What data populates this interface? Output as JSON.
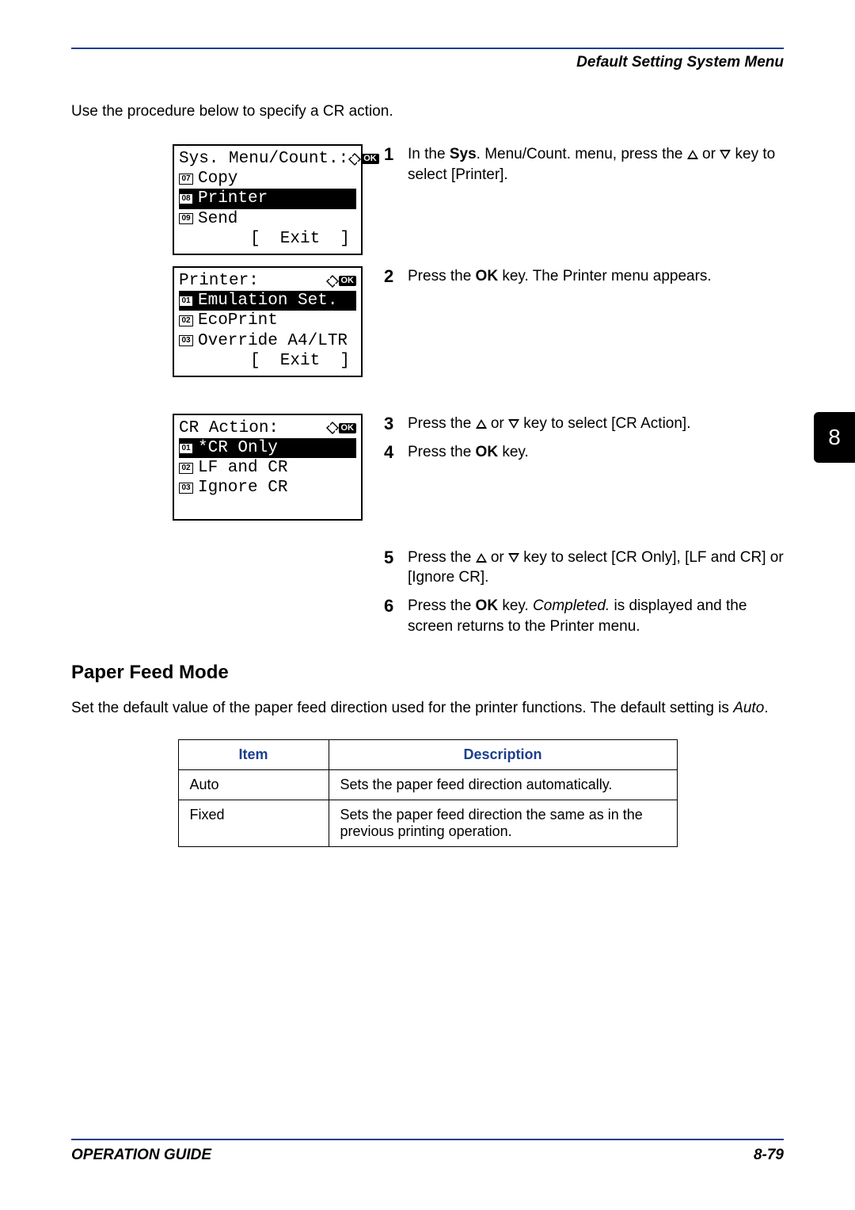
{
  "header": {
    "title": "Default Setting System Menu"
  },
  "intro": "Use the procedure below to specify a CR action.",
  "screens": {
    "s1": {
      "title": "Sys. Menu/Count.:",
      "items": [
        {
          "num": "07",
          "label": "Copy"
        },
        {
          "num": "08",
          "label": "Printer"
        },
        {
          "num": "09",
          "label": "Send"
        }
      ],
      "exit": "[  Exit  ]"
    },
    "s2": {
      "title": "Printer:",
      "items": [
        {
          "num": "01",
          "label": "Emulation Set."
        },
        {
          "num": "02",
          "label": "EcoPrint"
        },
        {
          "num": "03",
          "label": "Override A4/LTR"
        }
      ],
      "exit": "[  Exit  ]"
    },
    "s3": {
      "title": "CR Action:",
      "items": [
        {
          "num": "01",
          "label": "*CR Only"
        },
        {
          "num": "02",
          "label": "LF and CR"
        },
        {
          "num": "03",
          "label": "Ignore CR"
        }
      ]
    }
  },
  "steps": {
    "n1": "1",
    "t1a": "In the ",
    "t1b": "Sys",
    "t1c": ". Menu/Count. menu, press the ",
    "t1d": " or ",
    "t1e": " key to select [Printer].",
    "n2": "2",
    "t2a": "Press the ",
    "t2b": "OK",
    "t2c": " key. The Printer menu appears.",
    "n3": "3",
    "t3a": "Press the ",
    "t3b": " or ",
    "t3c": " key to select [CR Action].",
    "n4": "4",
    "t4a": "Press the ",
    "t4b": "OK",
    "t4c": " key.",
    "n5": "5",
    "t5a": "Press the ",
    "t5b": " or ",
    "t5c": " key to select [CR Only], [LF and CR] or [Ignore CR].",
    "n6": "6",
    "t6a": "Press the ",
    "t6b": "OK",
    "t6c": " key. ",
    "t6d": "Completed.",
    "t6e": " is displayed and the screen returns to the Printer menu."
  },
  "chapter": "8",
  "section": {
    "heading": "Paper Feed Mode",
    "intro_a": "Set the default value of the paper feed direction used for the printer functions. The default setting is ",
    "intro_b": "Auto",
    "intro_c": "."
  },
  "table": {
    "h1": "Item",
    "h2": "Description",
    "rows": [
      {
        "item": "Auto",
        "desc": "Sets the paper feed direction automatically."
      },
      {
        "item": "Fixed",
        "desc": "Sets the paper feed direction the same as in the previous printing operation."
      }
    ]
  },
  "footer": {
    "left": "OPERATION GUIDE",
    "right": "8-79"
  },
  "ok_label": "OK"
}
